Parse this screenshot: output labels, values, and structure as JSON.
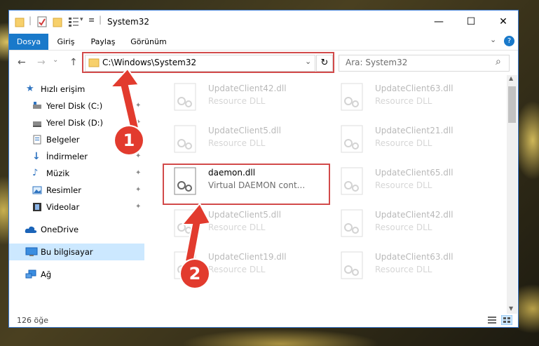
{
  "window": {
    "title": "System32"
  },
  "title_controls": {
    "minimize": "—",
    "maximize": "☐",
    "close": "✕"
  },
  "ribbon": {
    "tabs": [
      {
        "label": "Dosya"
      },
      {
        "label": "Giriş"
      },
      {
        "label": "Paylaş"
      },
      {
        "label": "Görünüm"
      }
    ],
    "collapse_glyph": "⌄",
    "help_glyph": "?"
  },
  "nav": {
    "back": "←",
    "forward": "→",
    "recent": "⌄",
    "up": "↑",
    "address": "C:\\Windows\\System32",
    "address_dropdown": "⌄",
    "refresh": "↻",
    "search_placeholder": "Ara: System32",
    "search_glyph": "⌕"
  },
  "sidebar": {
    "items": [
      {
        "label": "Hızlı erişim",
        "icon": "star-icon"
      },
      {
        "label": "Yerel Disk (C:)",
        "icon": "drive-icon",
        "pinned": true
      },
      {
        "label": "Yerel Disk (D:)",
        "icon": "drive-icon",
        "pinned": true
      },
      {
        "label": "Belgeler",
        "icon": "documents-icon",
        "pinned": true
      },
      {
        "label": "İndirmeler",
        "icon": "download-icon",
        "pinned": true
      },
      {
        "label": "Müzik",
        "icon": "music-icon",
        "pinned": true
      },
      {
        "label": "Resimler",
        "icon": "pictures-icon",
        "pinned": true
      },
      {
        "label": "Videolar",
        "icon": "videos-icon",
        "pinned": true
      },
      {
        "label": "OneDrive",
        "icon": "cloud-icon"
      },
      {
        "label": "Bu bilgisayar",
        "icon": "computer-icon",
        "selected": true
      },
      {
        "label": "Ağ",
        "icon": "network-icon"
      }
    ],
    "pin_glyph": "📌"
  },
  "files": [
    {
      "name": "UpdateClient42.dll",
      "type": "Resource DLL"
    },
    {
      "name": "UpdateClient63.dll",
      "type": "Resource DLL"
    },
    {
      "name": "UpdateClient5.dll",
      "type": "Resource DLL"
    },
    {
      "name": "UpdateClient21.dll",
      "type": "Resource DLL"
    },
    {
      "name": "daemon.dll",
      "type": "Virtual DAEMON cont..."
    },
    {
      "name": "UpdateClient65.dll",
      "type": "Resource DLL"
    },
    {
      "name": "UpdateClient5.dll",
      "type": "Resource DLL"
    },
    {
      "name": "UpdateClient42.dll",
      "type": "Resource DLL"
    },
    {
      "name": "UpdateClient19.dll",
      "type": "Resource DLL"
    },
    {
      "name": "UpdateClient63.dll",
      "type": "Resource DLL"
    }
  ],
  "status": {
    "count": "126 öğe"
  },
  "callouts": {
    "one": "1",
    "two": "2"
  },
  "colors": {
    "accent": "#1979ca",
    "highlight": "#d24a4a",
    "callout": "#e23b2e"
  }
}
